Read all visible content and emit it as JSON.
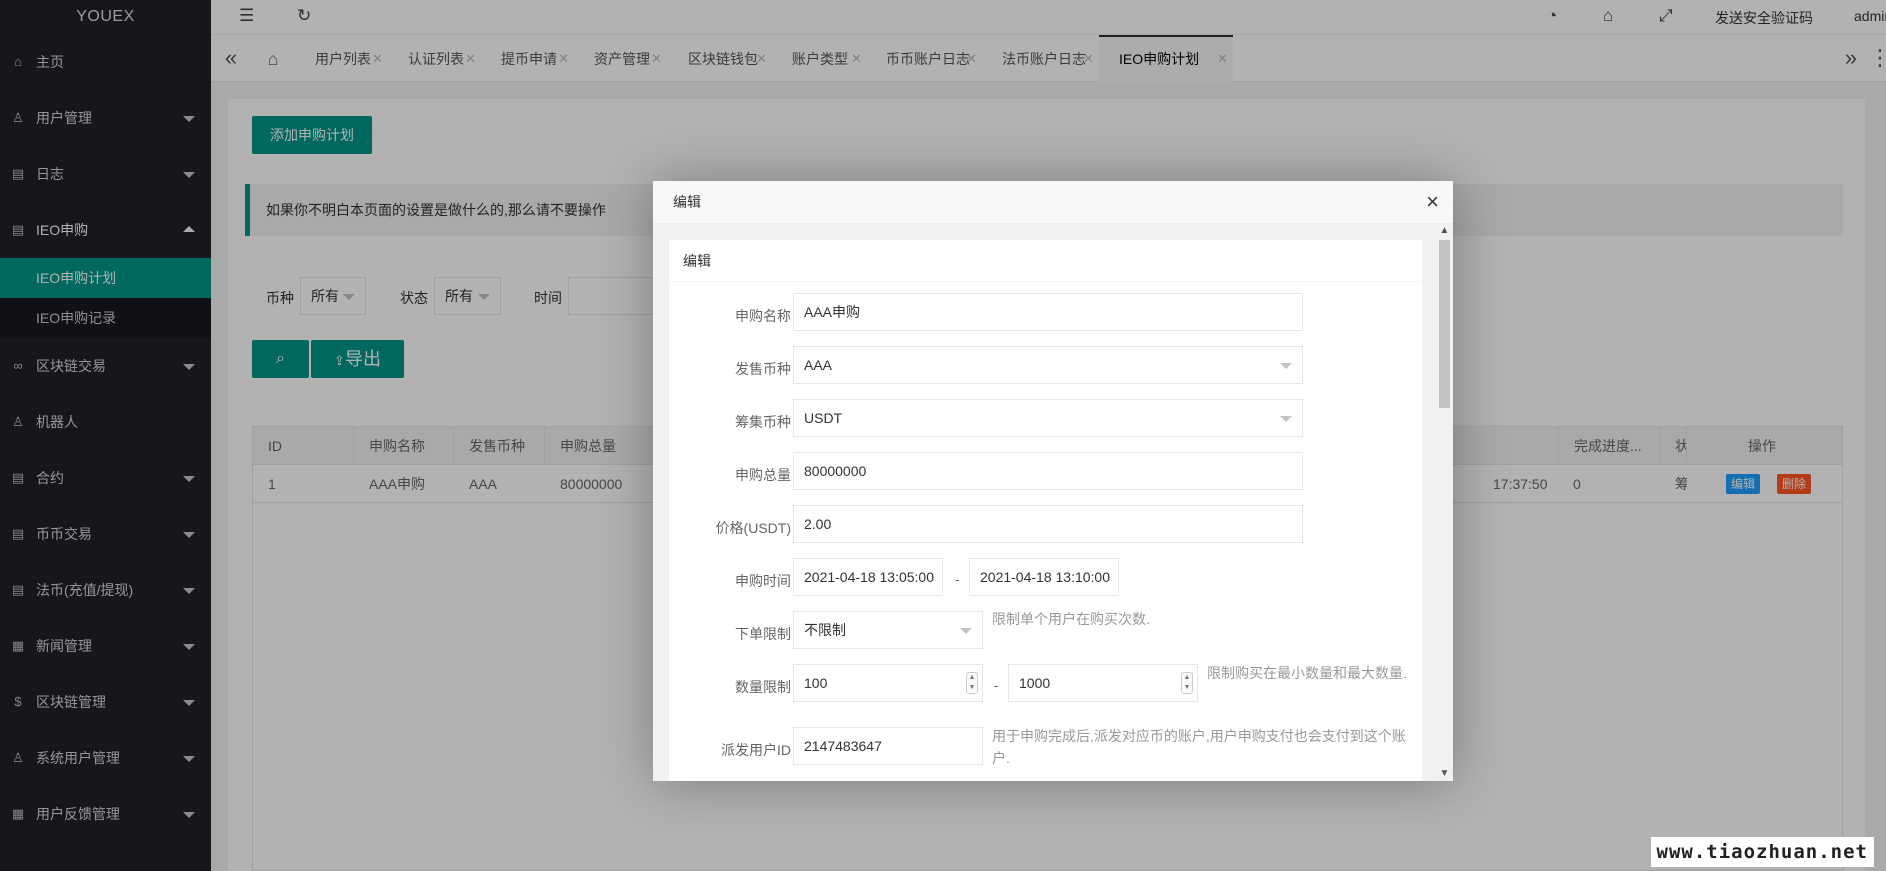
{
  "app": {
    "logo": "YOUEX"
  },
  "sidebar": {
    "items": [
      {
        "label": "主页",
        "icon": "home-icon",
        "glyph": "⌂"
      },
      {
        "label": "用户管理",
        "icon": "user-icon",
        "glyph": "♙"
      },
      {
        "label": "日志",
        "icon": "log-icon",
        "glyph": "▤"
      },
      {
        "label": "IEO申购",
        "icon": "ieo-icon",
        "glyph": "▤"
      },
      {
        "label": "区块链交易",
        "icon": "link-icon",
        "glyph": "∞"
      },
      {
        "label": "机器人",
        "icon": "robot-icon",
        "glyph": "♙"
      },
      {
        "label": "合约",
        "icon": "contract-icon",
        "glyph": "▤"
      },
      {
        "label": "币币交易",
        "icon": "exchange-icon",
        "glyph": "▤"
      },
      {
        "label": "法币(充值/提现)",
        "icon": "fiat-icon",
        "glyph": "▤"
      },
      {
        "label": "新闻管理",
        "icon": "news-icon",
        "glyph": "▦"
      },
      {
        "label": "区块链管理",
        "icon": "blockchain-icon",
        "glyph": "$"
      },
      {
        "label": "系统用户管理",
        "icon": "sysuser-icon",
        "glyph": "♙"
      },
      {
        "label": "用户反馈管理",
        "icon": "feedback-icon",
        "glyph": "▦"
      }
    ],
    "sub_items": [
      {
        "label": "IEO申购计划"
      },
      {
        "label": "IEO申购记录"
      }
    ]
  },
  "header": {
    "send_code": "发送安全验证码",
    "user": "admin"
  },
  "tabs": [
    {
      "label": "用户列表"
    },
    {
      "label": "认证列表"
    },
    {
      "label": "提币申请"
    },
    {
      "label": "资产管理"
    },
    {
      "label": "区块链钱包"
    },
    {
      "label": "账户类型"
    },
    {
      "label": "币币账户日志"
    },
    {
      "label": "法币账户日志"
    },
    {
      "label": "IEO申购计划"
    }
  ],
  "page": {
    "add_button": "添加申购计划",
    "notice": "如果你不明白本页面的设置是做什么的,那么请不要操作",
    "filter": {
      "coin_label": "币种",
      "coin_value": "所有",
      "status_label": "状态",
      "status_value": "所有",
      "time_label": "时间"
    },
    "export_button": "导出",
    "table": {
      "headers": [
        "ID",
        "申购名称",
        "发售币种",
        "申购总量",
        "完成进度...",
        "状",
        "操作"
      ],
      "row": {
        "id": "1",
        "name": "AAA申购",
        "coin": "AAA",
        "total": "80000000",
        "time_tail": "17:37:50",
        "progress": "0",
        "status": "筹",
        "edit": "编辑",
        "delete": "删除"
      }
    }
  },
  "modal": {
    "title": "编辑",
    "card_title": "编辑",
    "fields": {
      "name_label": "申购名称",
      "name_value": "AAA申购",
      "sale_coin_label": "发售币种",
      "sale_coin_value": "AAA",
      "raise_coin_label": "筹集币种",
      "raise_coin_value": "USDT",
      "total_label": "申购总量",
      "total_value": "80000000",
      "price_label": "价格(USDT)",
      "price_value": "2.00",
      "time_label": "申购时间",
      "time_start": "2021-04-18 13:05:00",
      "time_end": "2021-04-18 13:10:00",
      "order_limit_label": "下单限制",
      "order_limit_value": "不限制",
      "order_limit_tip": "限制单个用户在购买次数.",
      "qty_label": "数量限制",
      "qty_min": "100",
      "qty_max": "1000",
      "qty_tip": "限制购买在最小数量和最大数量.",
      "uid_label": "派发用户ID",
      "uid_value": "2147483647",
      "uid_tip": "用于申购完成后,派发对应币的账户,用户申购支付也会支付到这个账户."
    }
  },
  "watermark": "www.tiaozhuan.net",
  "colors": {
    "accent": "#009688",
    "sidebar": "#20222a",
    "edit": "#1E9FFF",
    "delete": "#FF5722"
  }
}
